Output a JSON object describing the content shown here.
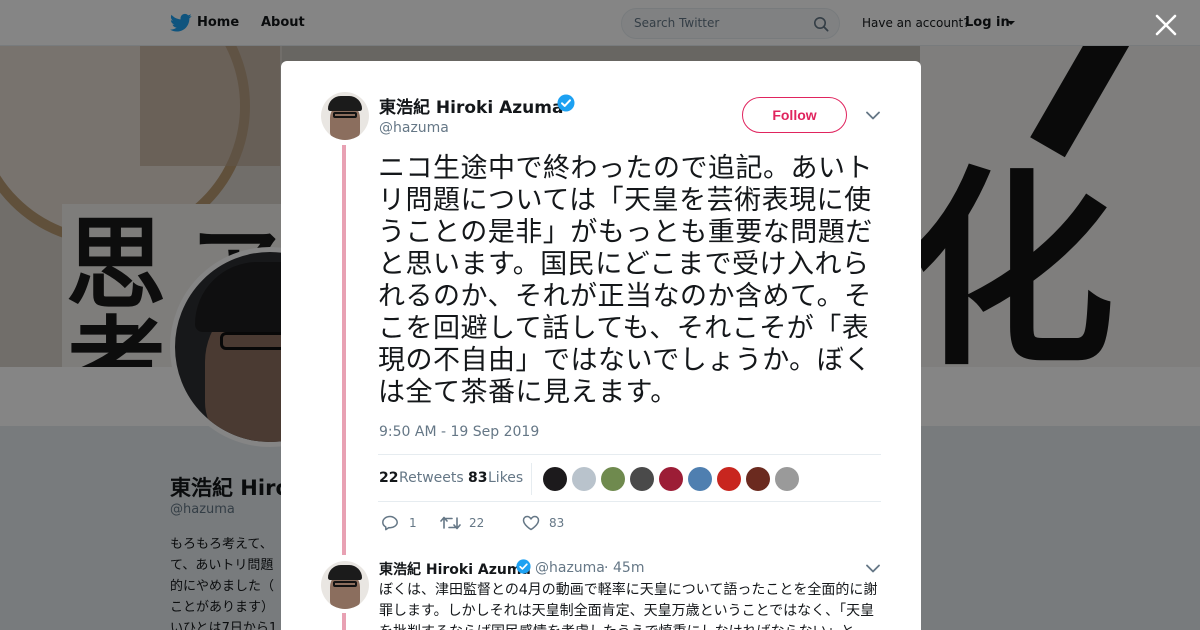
{
  "nav": {
    "home_label": "Home",
    "about_label": "About",
    "search_placeholder": "Search Twitter",
    "have_account": "Have an account?",
    "login_label": "Log in"
  },
  "colors": {
    "brand_blue": "#1da1f2",
    "follow_pink": "#e0245e",
    "thread_line": "#e8a1b3",
    "muted_text": "#657786"
  },
  "profile": {
    "name": "東浩紀 Hiro",
    "handle": "@hazuma",
    "bio_lines": [
      "もろもろ考えて、",
      "て、あいトリ問題",
      "的にやめました（",
      "ことがあります）",
      "いひとは7日から1"
    ]
  },
  "tweet": {
    "author_name": "東浩紀 Hiroki Azuma",
    "author_handle": "@hazuma",
    "follow_label": "Follow",
    "text": "ニコ生途中で終わったので追記。あいトリ問題については「天皇を芸術表現に使うことの是非」がもっとも重要な問題だと思います。国民にどこまで受け入れられるのか、それが正当なのか含めて。そこを回避して話しても、それこそが「表現の不自由」ではないでしょうか。ぼくは全て茶番に見えます。",
    "timestamp": "9:50 AM - 19 Sep 2019",
    "retweets_count": "22",
    "retweets_label": "Retweets",
    "likes_count": "83",
    "likes_label": "Likes",
    "liker_avatar_colors": [
      "#1c1a1c",
      "#b9c3cc",
      "#6f8a4e",
      "#4a4a4a",
      "#9c1d36",
      "#4f7fb0",
      "#c8261f",
      "#6b2a1f",
      "#9a9a9a"
    ],
    "actions": {
      "reply_count": "1",
      "retweet_count": "22",
      "like_count": "83"
    }
  },
  "reply": {
    "author_name": "東浩紀 Hiroki Azuma",
    "author_handle": "@hazuma",
    "dot": "·",
    "time": "45m",
    "text": "ぼくは、津田監督との4月の動画で軽率に天皇について語ったことを全面的に謝罪します。しかしそれは天皇制全面肯定、天皇万歳ということではなく、「天皇を批判するならば国民感情を考慮したうえで慎重にしなければならない」と"
  }
}
